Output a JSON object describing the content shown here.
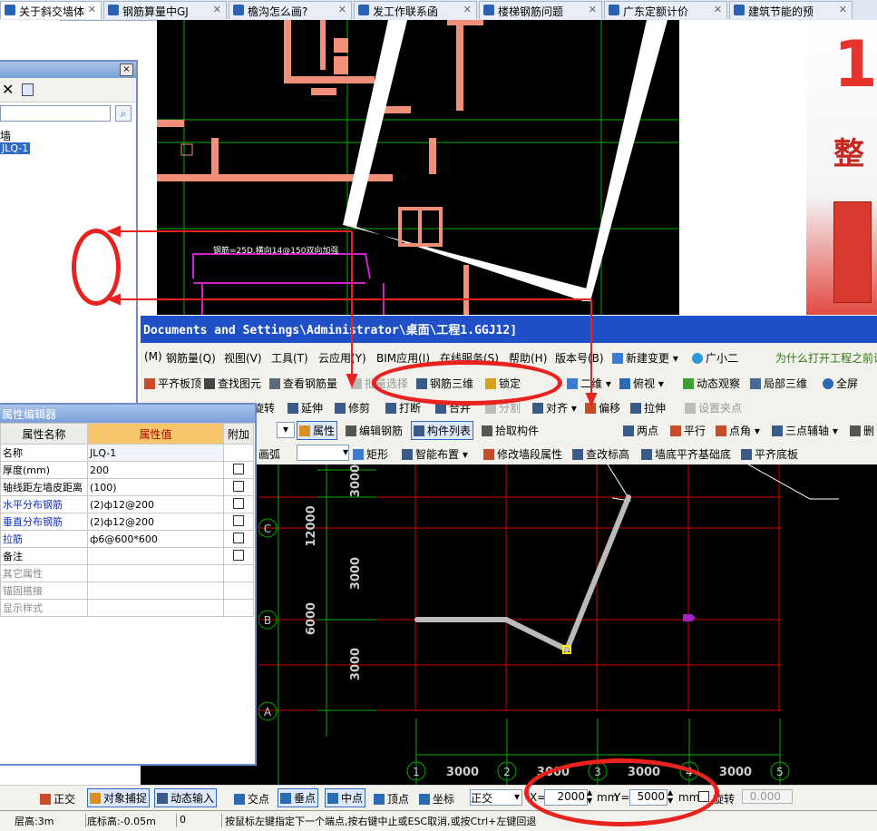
{
  "browser_tabs": [
    {
      "label": "关于斜交墙体",
      "close": "✕"
    },
    {
      "label": "钢筋算量中GJ",
      "close": "✕"
    },
    {
      "label": "檐沟怎么画?",
      "close": "✕"
    },
    {
      "label": "发工作联系函",
      "close": "✕"
    },
    {
      "label": "楼梯钢筋问题",
      "close": "✕"
    },
    {
      "label": "广东定额计价",
      "close": "✕"
    },
    {
      "label": "建筑节能的预",
      "close": "✕"
    }
  ],
  "ad": {
    "big": "1",
    "small": "整"
  },
  "component_dialog": {
    "close": "×",
    "search_placeholder": "",
    "tree_item1": "墙",
    "tree_item2": "JLQ-1"
  },
  "cad_top": {
    "annotation": "钢筋=25D.横向14@150双向加强"
  },
  "app_title": "Documents and Settings\\Administrator\\桌面\\工程1.GGJ12]",
  "menu": [
    "(M)",
    "钢筋量(Q)",
    "视图(V)",
    "工具(T)",
    "云应用(Y)",
    "BIM应用(I)",
    "在线服务(S)",
    "帮助(H)",
    "版本号(B)",
    "新建变更",
    "广小二",
    "为什么打开工程之前论"
  ],
  "toolbar1": [
    "平齐板顶",
    "查找图元",
    "查看钢筋量",
    "批量选择",
    "钢筋三维",
    "锁定",
    "二维",
    "俯视",
    "动态观察",
    "局部三维",
    "全屏"
  ],
  "toolbar2": [
    "旋转",
    "延伸",
    "修剪",
    "打断",
    "合并",
    "分割",
    "对齐",
    "偏移",
    "拉伸",
    "设置夹点"
  ],
  "toolbar3": [
    "属性",
    "编辑钢筋",
    "构件列表",
    "拾取构件",
    "两点",
    "平行",
    "点角",
    "三点辅轴",
    "删"
  ],
  "toolbar4": [
    "画弧",
    "矩形",
    "智能布置",
    "修改墙段属性",
    "查改标高",
    "墙底平齐基础底",
    "平齐底板"
  ],
  "property_panel": {
    "title": "属性编辑器",
    "headers": [
      "属性名称",
      "属性值",
      "附加"
    ],
    "rows": [
      {
        "name": "名称",
        "value": "JLQ-1",
        "style": "normal",
        "check": false
      },
      {
        "name": "厚度(mm)",
        "value": "200",
        "style": "normal",
        "check": true
      },
      {
        "name": "轴线距左墙皮距离",
        "value": "(100)",
        "style": "normal",
        "check": true
      },
      {
        "name": "水平分布钢筋",
        "value": "(2)ф12@200",
        "style": "blue",
        "check": true
      },
      {
        "name": "垂直分布钢筋",
        "value": "(2)ф12@200",
        "style": "blue",
        "check": true
      },
      {
        "name": "拉筋",
        "value": "ф6@600*600",
        "style": "blue",
        "check": true
      },
      {
        "name": "备注",
        "value": "",
        "style": "normal",
        "check": true
      },
      {
        "name": "其它属性",
        "value": "",
        "style": "gray",
        "check": false
      },
      {
        "name": "锚固搭接",
        "value": "",
        "style": "gray",
        "check": false
      },
      {
        "name": "显示样式",
        "value": "",
        "style": "gray",
        "check": false
      }
    ]
  },
  "cad_main": {
    "axis_rows": [
      "C",
      "B",
      "A"
    ],
    "axis_cols": [
      "1",
      "2",
      "3",
      "4",
      "5"
    ],
    "dims_left": [
      "3000",
      "12000",
      "3000",
      "6000",
      "3000"
    ],
    "dims_bottom": [
      "3000",
      "3000",
      "3000",
      "3000"
    ]
  },
  "bottom_toolbar": {
    "ortho": "正交",
    "snap": "对象捕捉",
    "dynamic": "动态输入",
    "intersect": "交点",
    "perp": "垂点",
    "mid": "中点",
    "vertex": "顶点",
    "coord": "坐标",
    "mode": "正交",
    "x_label": "X=",
    "x_value": "2000",
    "x_unit": "mm",
    "y_label": "Y=",
    "y_value": "5000",
    "y_unit": "mm",
    "rotate": "旋转",
    "rotate_value": "0.000"
  },
  "status": {
    "floor_height": "层高:3m",
    "bottom_elev": "底标高:-0.05m",
    "zero": "0",
    "hint": "按鼠标左键指定下一个端点,按右键中止或ESC取消,或按Ctrl+左键回退"
  }
}
